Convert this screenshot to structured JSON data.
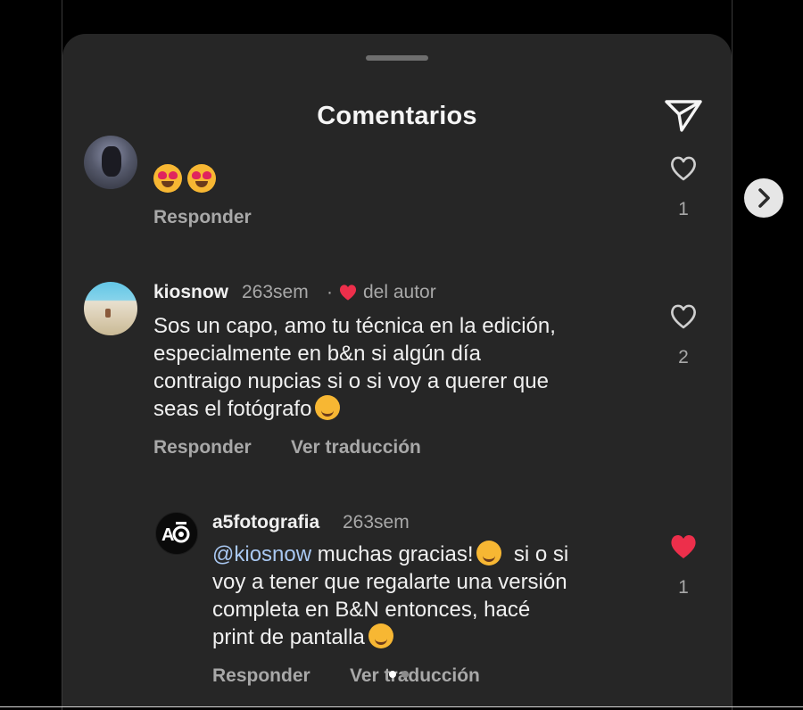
{
  "sheet": {
    "title": "Comentarios"
  },
  "comments": [
    {
      "emojis": [
        "smiling-face-with-heart-eyes",
        "smiling-face-with-heart-eyes"
      ],
      "reply_label": "Responder",
      "like_count": "1",
      "liked": false
    },
    {
      "username": "kiosnow",
      "time": "263sem",
      "separator": "·",
      "author_like_label": "del autor",
      "text": "Sos un capo, amo tu técnica en la edición,\nespecialmente en b&n si algún día\ncontraigo nupcias si o si voy a querer que\nseas el fotógrafo",
      "reply_label": "Responder",
      "translate_label": "Ver traducción",
      "like_count": "2",
      "liked": false
    },
    {
      "username": "a5fotografia",
      "time": "263sem",
      "mention": "@kiosnow",
      "text_line1": " muchas gracias!",
      "text_line1b": "  si o si",
      "text_rest": "voy a tener que regalarte una versión\ncompleta en B&N entonces, hacé\nprint de pantalla",
      "reply_label": "Responder",
      "translate_label": "Ver traducción",
      "like_count": "1",
      "liked": true
    }
  ],
  "colors": {
    "sheet_bg": "#262626",
    "like_red": "#ed2f4b",
    "mention_blue": "#a9c8f2",
    "muted_text": "#a8a8a8"
  },
  "carousel": {
    "dots": 2,
    "active_index": 0
  }
}
